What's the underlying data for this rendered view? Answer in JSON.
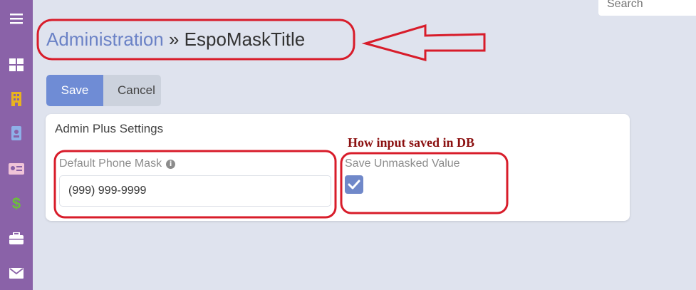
{
  "sidebar": {
    "items": [
      {
        "icon": "menu-icon"
      },
      {
        "icon": "dashboard-icon"
      },
      {
        "icon": "building-icon"
      },
      {
        "icon": "contact-card-icon"
      },
      {
        "icon": "id-card-icon"
      },
      {
        "icon": "dollar-icon"
      },
      {
        "icon": "briefcase-icon"
      },
      {
        "icon": "envelope-icon"
      }
    ],
    "background": "#8a62a8"
  },
  "search": {
    "placeholder": "Search"
  },
  "breadcrumb": {
    "root": "Administration",
    "separator": " » ",
    "current": "EspoMaskTitle"
  },
  "toolbar": {
    "save_label": "Save",
    "cancel_label": "Cancel"
  },
  "panel": {
    "title": "Admin Plus Settings",
    "phone_mask": {
      "label": "Default Phone Mask",
      "value": "(999) 999-9999"
    },
    "unmasked": {
      "label": "Save Unmasked Value",
      "checked": true
    }
  },
  "annotation": {
    "note": "How input saved in DB",
    "color": "#d81c2a"
  },
  "colors": {
    "accent": "#6f8cd5",
    "link": "#6b82c6",
    "page_bg": "#dfe3ee"
  }
}
